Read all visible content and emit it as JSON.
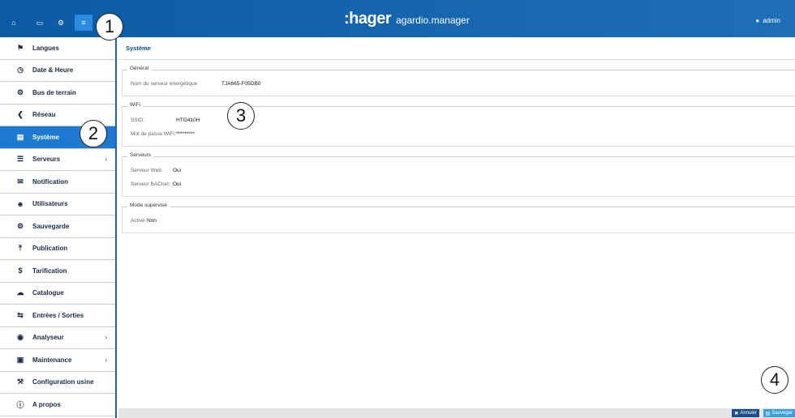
{
  "topbar": {
    "brand": ":hager",
    "product": "agardio.manager",
    "user": "admin"
  },
  "callouts": [
    "1",
    "2",
    "3",
    "4"
  ],
  "sidebar": {
    "items": [
      {
        "label": "Langues",
        "icon": "flag-icon"
      },
      {
        "label": "Date & Heure",
        "icon": "clock-icon"
      },
      {
        "label": "Bus de terrain",
        "icon": "cogs-icon"
      },
      {
        "label": "Réseau",
        "icon": "share-icon"
      },
      {
        "label": "Système",
        "icon": "hdd-icon"
      },
      {
        "label": "Serveurs",
        "icon": "server-icon"
      },
      {
        "label": "Notification",
        "icon": "envelope-icon"
      },
      {
        "label": "Utilisateurs",
        "icon": "users-icon"
      },
      {
        "label": "Sauvegarde",
        "icon": "cogs-icon"
      },
      {
        "label": "Publication",
        "icon": "upload-icon"
      },
      {
        "label": "Tarification",
        "icon": "dollar-icon"
      },
      {
        "label": "Catalogue",
        "icon": "cloud-upload-icon"
      },
      {
        "label": "Entrées / Sorties",
        "icon": "exchange-icon"
      },
      {
        "label": "Analyseur",
        "icon": "eye-icon"
      },
      {
        "label": "Maintenance",
        "icon": "toolbox-icon"
      },
      {
        "label": "Configuration usine",
        "icon": "wrench-icon"
      },
      {
        "label": "A propos",
        "icon": "info-icon"
      }
    ]
  },
  "main": {
    "title": "Système",
    "general": {
      "legend": "Général",
      "server_name_label": "Nom du serveur énergétique",
      "server_name_value": "TJA665-F05DB0"
    },
    "wifi": {
      "legend": "WiFi",
      "ssid_label": "SSID:",
      "ssid_value": "HTG410H",
      "password_label": "Mot de passe WiFi:",
      "password_value": "*********"
    },
    "servers": {
      "legend": "Serveurs",
      "web_label": "Serveur Web:",
      "web_value": "Oui",
      "bacnet_label": "Serveur BACnet:",
      "bacnet_value": "Oui"
    },
    "supervised": {
      "legend": "Mode supervisé",
      "active_label": "Activé",
      "active_value": "Non"
    }
  },
  "footer": {
    "cancel_label": "Annuler",
    "save_label": "Sauvegar"
  }
}
